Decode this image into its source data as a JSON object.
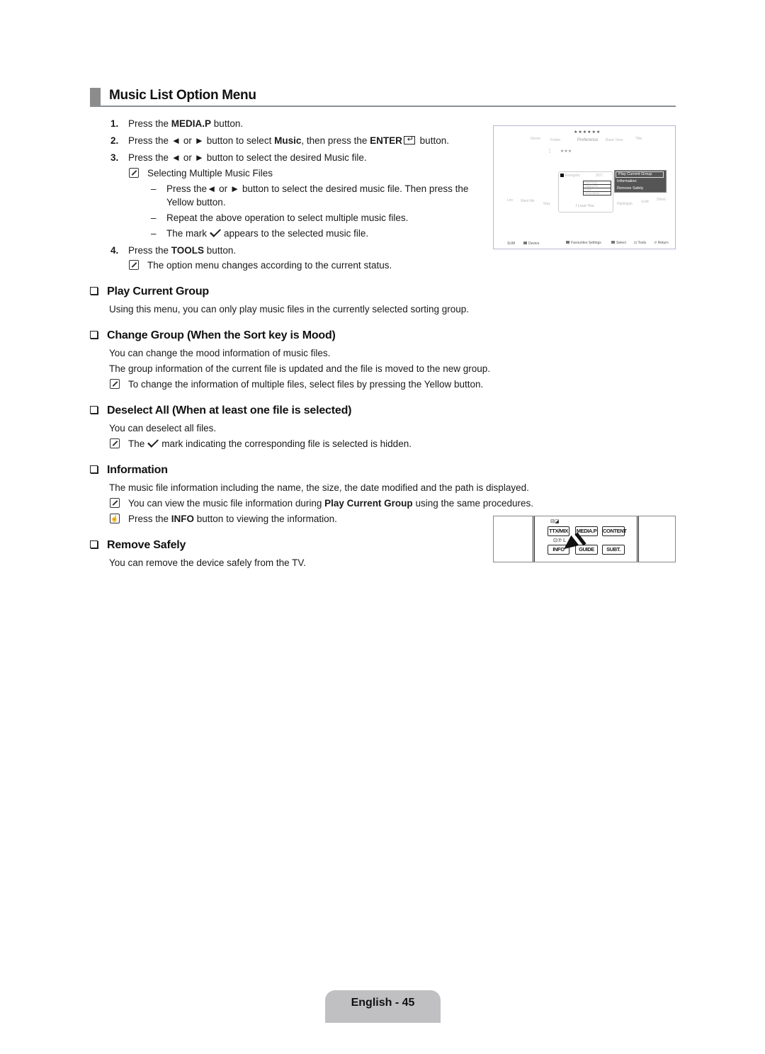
{
  "page": {
    "title": "Music List Option Menu",
    "footer": "English - 45"
  },
  "steps": {
    "s1": {
      "num": "1.",
      "pre": "Press the ",
      "bold": "MEDIA.P",
      "post": " button."
    },
    "s2": {
      "num": "2.",
      "pre": "Press the ◄ or ► button to select ",
      "bold1": "Music",
      "mid": ", then press the ",
      "bold2": "ENTER",
      "post": " button."
    },
    "s3": {
      "num": "3.",
      "text": "Press the ◄ or ► button to select the desired Music file."
    },
    "s3_note": "Selecting Multiple Music Files",
    "s3_sub": [
      "Press the◄ or ► button to select the desired music file. Then press the",
      "Yellow button.",
      "Repeat the above operation to select multiple music files.",
      "The mark",
      "appears to the selected music file."
    ],
    "s4": {
      "num": "4.",
      "pre": "Press the ",
      "bold": "TOOLS",
      "post": " button."
    },
    "s4_note": "The option menu changes according to the current status.",
    "dash": "–"
  },
  "sections": {
    "play": {
      "heading": "Play Current Group",
      "body": "Using this menu, you can only play music files in the currently selected sorting group."
    },
    "change": {
      "heading": "Change Group (When the Sort key is Mood)",
      "body1": "You can change the mood information of music files.",
      "body2": "The group information of the current file is updated and the file is moved to the new group.",
      "note": "To change the information of multiple files, select files by pressing the Yellow button."
    },
    "deselect": {
      "heading": "Deselect All (When at least one file is selected)",
      "body": "You can deselect all files.",
      "note_pre": "The",
      "note_post": "mark indicating the corresponding file is selected is hidden."
    },
    "information": {
      "heading": "Information",
      "body": "The music file information including the name, the size, the date modified and the path is displayed.",
      "note_pre": "You can view the music file information during ",
      "note_bold": "Play Current Group",
      "note_post": " using the same procedures.",
      "tip_pre": "Press the ",
      "tip_bold": "INFO",
      "tip_post": " button to viewing the information."
    },
    "remove": {
      "heading": "Remove Safely",
      "body": "You can remove the device safely from the TV."
    }
  },
  "tv_screen": {
    "stars_top": "★★★★★★",
    "tabs": [
      "Genre",
      "Folder",
      "Preference",
      "Basic View",
      "Title"
    ],
    "stars_mid": "★★★",
    "left_items": [
      "Lim",
      "Want Me",
      "Way"
    ],
    "mood_label": "Energetic",
    "mood_count": "3/37",
    "mood_list": [
      "Sad Rock",
      "Happy ED",
      "Calm",
      "Soundtrack"
    ],
    "song": "I Love You",
    "right_items": [
      "Hallelujah",
      "Gold",
      "Shine"
    ],
    "popup_menu": [
      "Play Current Group",
      "Information",
      "Remove Safely"
    ],
    "bottom_left": [
      "SUM",
      "Device"
    ],
    "bottom_right": [
      "Favourites Settings",
      "Select",
      "Tools",
      "Return"
    ]
  },
  "remote": {
    "buttons": [
      "TTX/MIX",
      "MEDIA.P",
      "CONTENT",
      "INFO",
      "GUIDE",
      "SUBT."
    ],
    "top_icons": "⊟◪",
    "mid_icons": "⊡⑦ L"
  }
}
